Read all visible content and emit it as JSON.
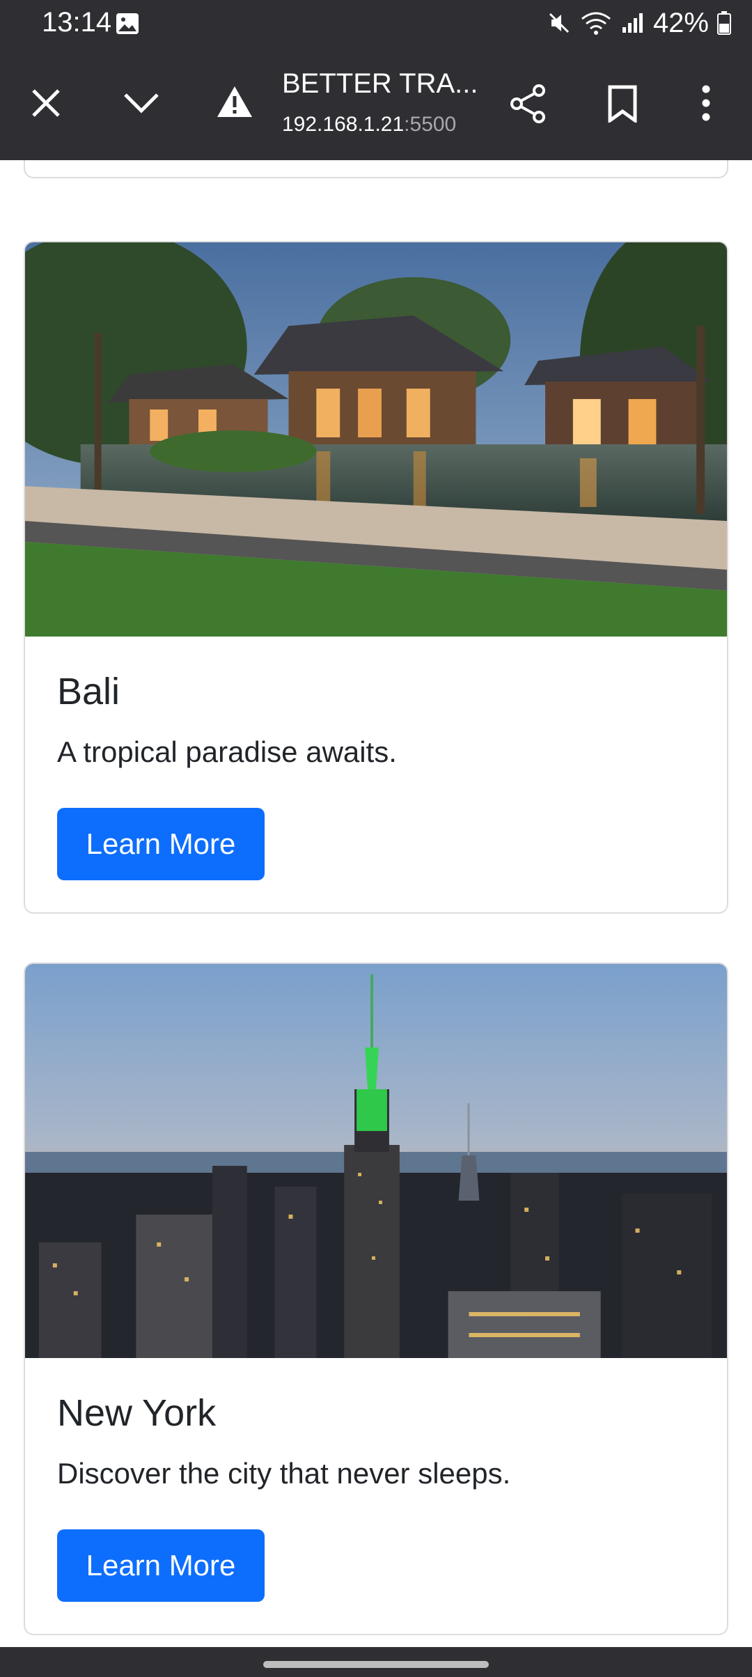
{
  "status_bar": {
    "time": "13:14",
    "battery": "42%"
  },
  "browser": {
    "page_title": "BETTER TRA...",
    "host": "192.168.1.21",
    "port": ":5500",
    "icons": [
      "close-icon",
      "chevron-down-icon",
      "warning-icon",
      "share-icon",
      "bookmark-icon",
      "more-vert-icon"
    ]
  },
  "cards": [
    {
      "title": "Bali",
      "text": "A tropical paradise awaits.",
      "button_label": "Learn More"
    },
    {
      "title": "New York",
      "text": "Discover the city that never sleeps.",
      "button_label": "Learn More"
    }
  ],
  "colors": {
    "primary_button": "#0d6efd",
    "browser_chrome": "#2f2f33"
  }
}
